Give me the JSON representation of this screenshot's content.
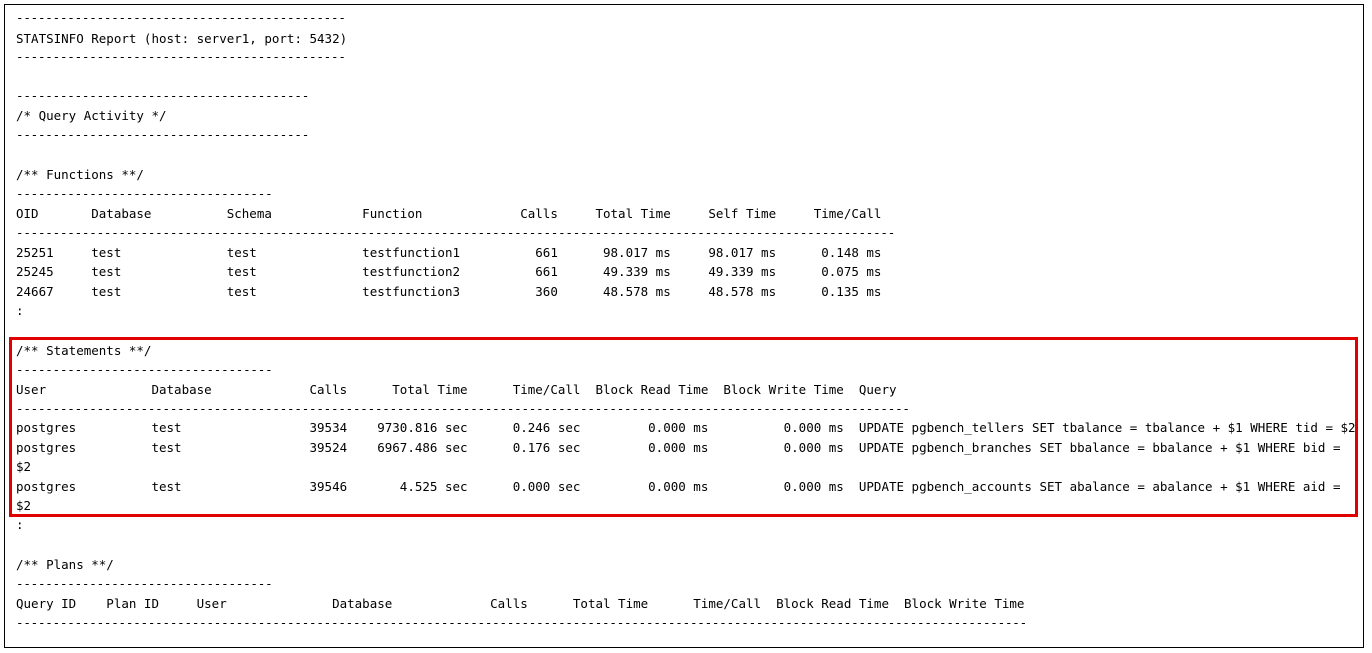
{
  "lines": {
    "sep_top_a": "---------------------------------------------",
    "title": "STATSINFO Report (host: server1, port: 5432)",
    "sep_top_b": "---------------------------------------------",
    "sep_qa_a": "----------------------------------------",
    "query_activity": "/* Query Activity */",
    "sep_qa_b": "----------------------------------------",
    "functions_title": "/** Functions **/",
    "sep_func": "-----------------------------------",
    "func_header": "OID       Database          Schema            Function             Calls     Total Time     Self Time     Time/Call",
    "sep_func_hdr": "------------------------------------------------------------------------------------------------------------------------",
    "func_row1": "25251     test              test              testfunction1          661      98.017 ms     98.017 ms      0.148 ms",
    "func_row2": "25245     test              test              testfunction2          661      49.339 ms     49.339 ms      0.075 ms",
    "func_row3": "24667     test              test              testfunction3          360      48.578 ms     48.578 ms      0.135 ms",
    "func_more": ":",
    "statements_title": "/** Statements **/",
    "sep_stmt": "-----------------------------------",
    "stmt_header": "User              Database             Calls      Total Time      Time/Call  Block Read Time  Block Write Time  Query",
    "sep_stmt_hdr": "--------------------------------------------------------------------------------------------------------------------------",
    "stmt_row1": "postgres          test                 39534    9730.816 sec      0.246 sec         0.000 ms          0.000 ms  UPDATE pgbench_tellers SET tbalance = tbalance + $1 WHERE tid = $2",
    "stmt_row2": "postgres          test                 39524    6967.486 sec      0.176 sec         0.000 ms          0.000 ms  UPDATE pgbench_branches SET bbalance = bbalance + $1 WHERE bid =",
    "stmt_row2_cont": "$2",
    "stmt_row3": "postgres          test                 39546       4.525 sec      0.000 sec         0.000 ms          0.000 ms  UPDATE pgbench_accounts SET abalance = abalance + $1 WHERE aid =",
    "stmt_row3_cont": "$2",
    "stmt_more": ":",
    "plans_title": "/** Plans **/",
    "sep_plans": "-----------------------------------",
    "plans_header": "Query ID    Plan ID     User              Database             Calls      Total Time      Time/Call  Block Read Time  Block Write Time",
    "sep_plans_hdr": "------------------------------------------------------------------------------------------------------------------------------------------"
  },
  "colors": {
    "highlight": "#e00000",
    "text": "#000000"
  }
}
